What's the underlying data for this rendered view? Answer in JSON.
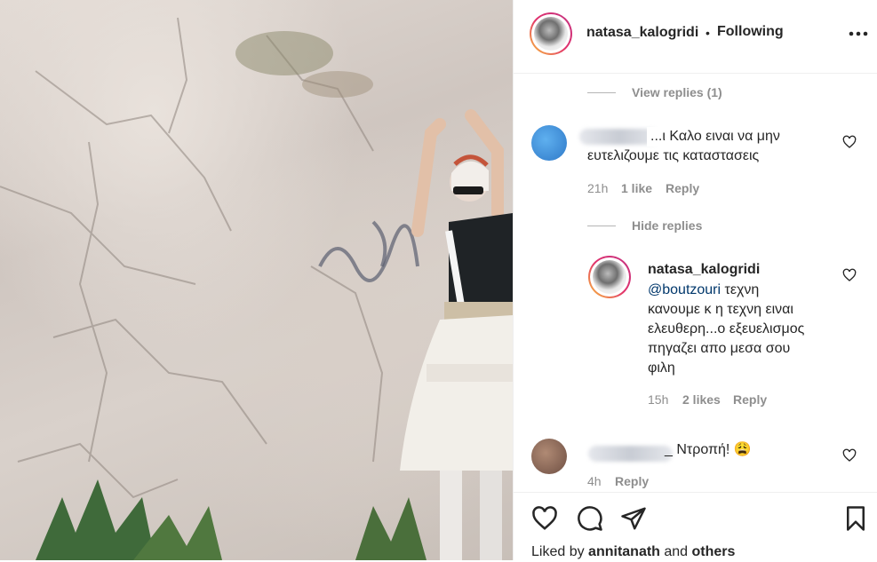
{
  "header": {
    "username": "natasa_kalogridi",
    "separator": "•",
    "follow_status": "Following",
    "more_icon": "more-horizontal-icon"
  },
  "thread": {
    "view_replies": "View replies (1)",
    "comment1": {
      "text_line1": "...ι Καλο ειναι να μην",
      "text_line2": "ευτελιζουμε τις καταστασεις",
      "time": "21h",
      "likes": "1 like",
      "reply": "Reply"
    },
    "hide_replies": "Hide replies",
    "reply1": {
      "username": "natasa_kalogridi",
      "mention": "@boutzouri",
      "text_line1": " τεχνη",
      "text_line2": "κανουμε κ η τεχνη ειναι",
      "text_line3": "ελευθερη...ο εξευελισμος",
      "text_line4": "πηγαζει απο μεσα σου",
      "text_line5": "φιλη",
      "time": "15h",
      "likes": "2 likes",
      "reply": "Reply"
    },
    "comment2": {
      "text": "_ Ντροπή! 😩",
      "time": "4h",
      "reply": "Reply"
    }
  },
  "footer": {
    "liked_prefix": "Liked by ",
    "liked_user": "annitanath",
    "liked_and": " and ",
    "liked_others": "others"
  },
  "colors": {
    "text": "#262626",
    "secondary": "#8e8e8e",
    "mention": "#00376b",
    "border": "#efefef"
  }
}
